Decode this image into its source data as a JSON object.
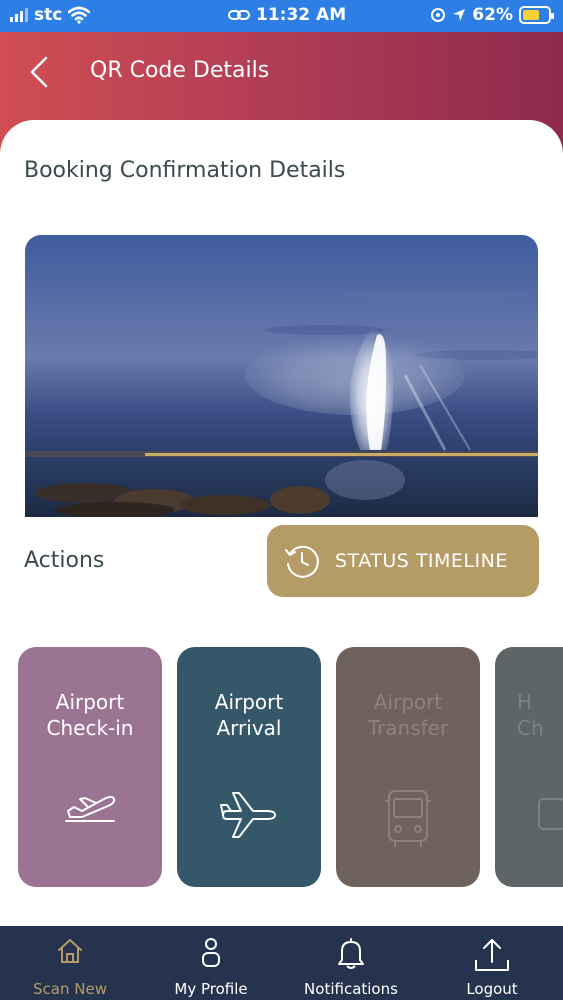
{
  "status_bar": {
    "carrier": "stc",
    "time": "11:32 AM",
    "battery_percent": "62%",
    "battery_level": 0.62
  },
  "header": {
    "title": "QR Code Details",
    "gradient_colors": [
      "#d04e52",
      "#b23e55",
      "#8e2a4d"
    ]
  },
  "section": {
    "title": "Booking Confirmation Details"
  },
  "actions": {
    "label": "Actions",
    "status_button_label": "STATUS TIMELINE",
    "status_button_color": "#b59c66",
    "cards": [
      {
        "label_line1": "Airport",
        "label_line2": "Check-in",
        "icon": "plane-takeoff-icon",
        "color": "#9b7493"
      },
      {
        "label_line1": "Airport",
        "label_line2": "Arrival",
        "icon": "airplane-icon",
        "color": "#35576a"
      },
      {
        "label_line1": "Airport",
        "label_line2": "Transfer",
        "icon": "bus-icon",
        "color": "#6f625c"
      },
      {
        "label_line1": "H",
        "label_line2": "Ch",
        "icon": "suitcase-icon",
        "color": "#5d6566"
      }
    ]
  },
  "tab_bar": {
    "items": [
      {
        "label": "Scan New",
        "icon": "home-icon",
        "active": true
      },
      {
        "label": "My Profile",
        "icon": "person-icon",
        "active": false
      },
      {
        "label": "Notifications",
        "icon": "bell-icon",
        "active": false
      },
      {
        "label": "Logout",
        "icon": "upload-icon",
        "active": false
      }
    ],
    "background": "#26334e",
    "active_color": "#b59c66"
  }
}
